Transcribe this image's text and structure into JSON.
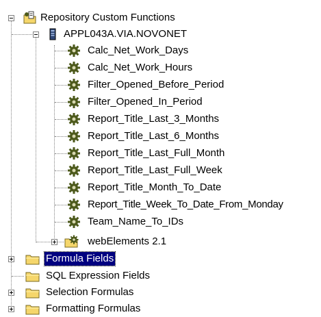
{
  "tree": {
    "root": {
      "label": "Repository Custom Functions",
      "icon": "repository-folder-icon",
      "expanded": true
    },
    "server": {
      "label": "APPL043A.VIA.NOVONET",
      "icon": "database-server-icon",
      "expanded": true
    },
    "functions": [
      {
        "label": "Calc_Net_Work_Days",
        "icon": "gear-icon"
      },
      {
        "label": "Calc_Net_Work_Hours",
        "icon": "gear-icon"
      },
      {
        "label": "Filter_Opened_Before_Period",
        "icon": "gear-icon"
      },
      {
        "label": "Filter_Opened_In_Period",
        "icon": "gear-icon"
      },
      {
        "label": "Report_Title_Last_3_Months",
        "icon": "gear-icon"
      },
      {
        "label": "Report_Title_Last_6_Months",
        "icon": "gear-icon"
      },
      {
        "label": "Report_Title_Last_Full_Month",
        "icon": "gear-icon"
      },
      {
        "label": "Report_Title_Last_Full_Week",
        "icon": "gear-icon"
      },
      {
        "label": "Report_Title_Month_To_Date",
        "icon": "gear-icon"
      },
      {
        "label": "Report_Title_Week_To_Date_From_Monday",
        "icon": "gear-icon"
      },
      {
        "label": "Team_Name_To_IDs",
        "icon": "gear-icon"
      }
    ],
    "web_elements": {
      "label": "webElements 2.1",
      "icon": "gear-folder-icon",
      "expanded": false
    },
    "top_nodes": [
      {
        "label": "Formula Fields",
        "icon": "folder-icon",
        "expanded": false,
        "selected": true
      },
      {
        "label": "SQL Expression Fields",
        "icon": "folder-icon",
        "expanded": null,
        "selected": false
      },
      {
        "label": "Selection Formulas",
        "icon": "folder-icon",
        "expanded": false,
        "selected": false
      },
      {
        "label": "Formatting Formulas",
        "icon": "folder-icon",
        "expanded": false,
        "selected": false
      }
    ]
  },
  "colors": {
    "selection_bg": "#000080",
    "selection_fg": "#ffffff",
    "folder": "#f5d66b",
    "gear": "#4d5a1c"
  }
}
